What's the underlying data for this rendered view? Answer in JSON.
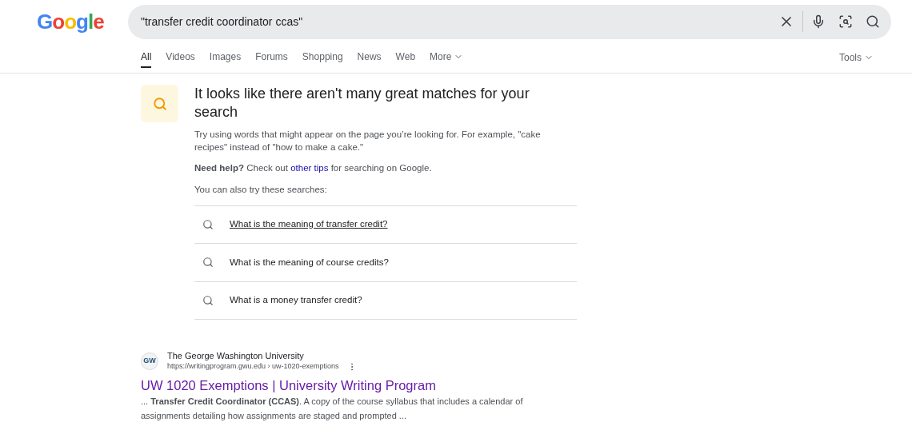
{
  "logo": "Google",
  "search": {
    "value": "\"transfer credit coordinator ccas\""
  },
  "tabs": [
    {
      "label": "All",
      "selected": true
    },
    {
      "label": "Videos",
      "selected": false
    },
    {
      "label": "Images",
      "selected": false
    },
    {
      "label": "Forums",
      "selected": false
    },
    {
      "label": "Shopping",
      "selected": false
    },
    {
      "label": "News",
      "selected": false
    },
    {
      "label": "Web",
      "selected": false
    },
    {
      "label": "More",
      "selected": false,
      "dropdown": true
    }
  ],
  "tools": "Tools",
  "notice": {
    "heading": "It looks like there aren't many great matches for your search",
    "tip": "Try using words that might appear on the page you’re looking for. For example, \"cake recipes\" instead of \"how to make a cake.\"",
    "help_before": "**Need help?** Check out ",
    "help_link": "other tips",
    "help_after": " for searching on Google.",
    "also": "You can also try these searches:"
  },
  "suggestions": [
    {
      "text": "What is the meaning of transfer credit?",
      "hovered": true
    },
    {
      "text": "What is the meaning of course credits?",
      "hovered": false
    },
    {
      "text": "What is a money transfer credit?",
      "hovered": false
    }
  ],
  "result": {
    "site": "The George Washington University",
    "url": "https://writingprogram.gwu.edu › uw-1020-exemptions",
    "favicon": "GW",
    "title": "UW 1020 Exemptions | University Writing Program",
    "snippet": "... **Transfer Credit Coordinator (CCAS)**. A copy of the course syllabus that includes a calendar of assignments detailing how assignments are staged and prompted ..."
  }
}
